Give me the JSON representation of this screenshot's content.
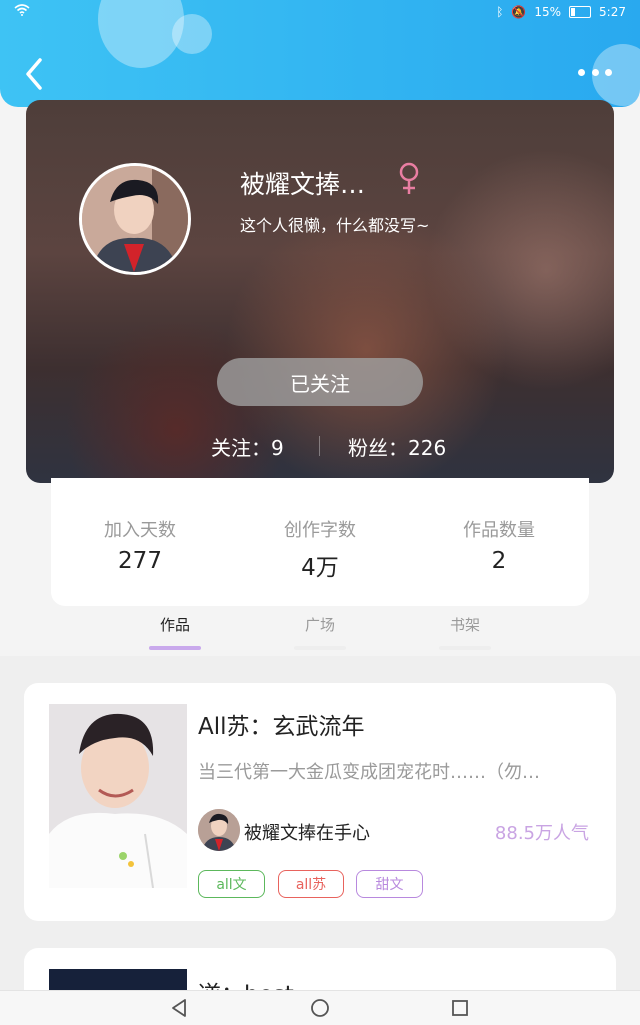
{
  "status_bar": {
    "battery": "15%",
    "time": "5:27"
  },
  "header": {
    "back_icon": "chevron-left-icon",
    "more_icon": "more-dots-icon"
  },
  "profile": {
    "nickname": "被耀文捧…",
    "gender_icon": "female-icon",
    "bio": "这个人很懒，什么都没写~",
    "follow_button": "已关注",
    "following_label": "关注：9",
    "fans_label": "粉丝：226"
  },
  "stats": [
    {
      "label": "加入天数",
      "value": "277"
    },
    {
      "label": "创作字数",
      "value": "4万"
    },
    {
      "label": "作品数量",
      "value": "2"
    }
  ],
  "tabs": [
    {
      "label": "作品",
      "active": true
    },
    {
      "label": "广场",
      "active": false
    },
    {
      "label": "书架",
      "active": false
    }
  ],
  "works": [
    {
      "title": "All苏：玄武流年",
      "description": "当三代第一大金瓜变成团宠花时……（勿…",
      "author": "被耀文捧在手心",
      "popularity": "88.5万人气",
      "tags": [
        {
          "label": "all文",
          "color": "#5cb85c"
        },
        {
          "label": "all苏",
          "color": "#e8635d"
        },
        {
          "label": "甜文",
          "color": "#b889de"
        }
      ]
    },
    {
      "title": "逆：best"
    }
  ],
  "colors": {
    "accent_purple": "#c9a9ec",
    "header_blue": "#36b7f2"
  }
}
